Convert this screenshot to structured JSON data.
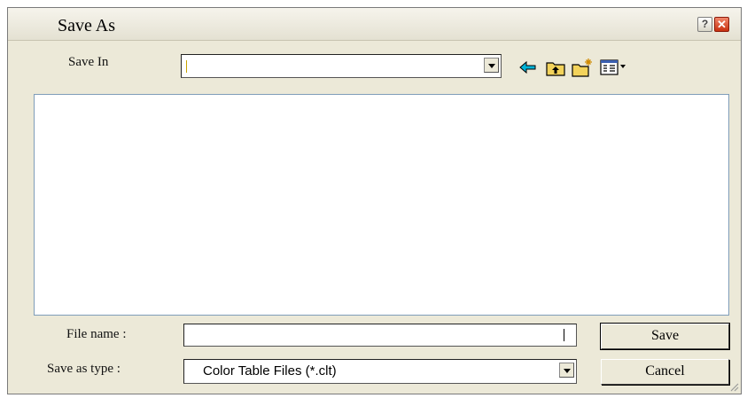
{
  "dialog": {
    "title": "Save As",
    "help_button": "?",
    "close_button": "✕"
  },
  "save_in": {
    "label": "Save In",
    "value": ""
  },
  "toolbar": {
    "icons": [
      "back-arrow-icon",
      "up-one-level-icon",
      "new-folder-icon",
      "view-menu-icon"
    ]
  },
  "file_name": {
    "label": "File name :",
    "value": ""
  },
  "save_as_type": {
    "label": "Save as type :",
    "value": "Color Table Files (*.clt)"
  },
  "buttons": {
    "save": "Save",
    "cancel": "Cancel"
  },
  "colors": {
    "dialog_background": "#ece9d8",
    "close_button": "#d8441f",
    "list_border": "#7f9db9",
    "back_arrow": "#00b4d8",
    "folder": "#f3d35b"
  }
}
